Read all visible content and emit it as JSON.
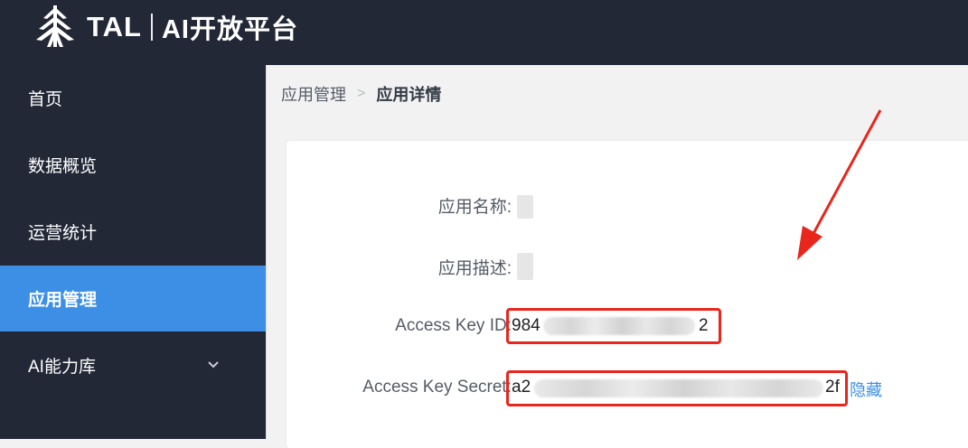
{
  "header": {
    "brand": "TAL",
    "product": "AI开放平台",
    "logo_icon": "tree-logo-icon"
  },
  "sidebar": {
    "items": [
      {
        "label": "首页"
      },
      {
        "label": "数据概览"
      },
      {
        "label": "运营统计"
      },
      {
        "label": "应用管理",
        "active": true
      },
      {
        "label": "AI能力库",
        "expandable": true
      }
    ]
  },
  "breadcrumb": {
    "parent": "应用管理",
    "separator": ">",
    "current": "应用详情"
  },
  "details": {
    "app_name_label": "应用名称:",
    "app_desc_label": "应用描述:",
    "access_key_id_label": "Access Key ID:",
    "access_key_id_prefix": "984",
    "access_key_id_suffix": "2",
    "access_key_secret_label": "Access Key Secret:",
    "access_key_secret_prefix": "a2",
    "access_key_secret_suffix": "2f",
    "hide_link": "隐藏"
  },
  "colors": {
    "sidebar_bg": "#232837",
    "active_item": "#3d8fe6",
    "highlight_box": "#e8261c",
    "link": "#3d8fe6"
  }
}
